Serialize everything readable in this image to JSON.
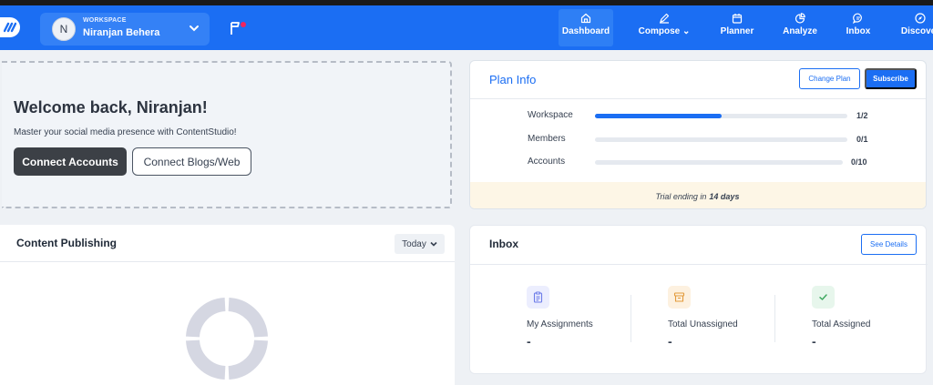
{
  "header": {
    "workspace_tag": "WORKSPACE",
    "workspace_name": "Niranjan Behera",
    "avatar_initial": "N",
    "tabs": [
      {
        "label": "Dashboard",
        "icon": "home-icon"
      },
      {
        "label": "Compose",
        "icon": "pen-icon"
      },
      {
        "label": "Planner",
        "icon": "calendar-icon"
      },
      {
        "label": "Analyze",
        "icon": "pie-chart-icon"
      },
      {
        "label": "Inbox",
        "icon": "chat-icon"
      },
      {
        "label": "Discover",
        "icon": "compass-icon"
      }
    ],
    "active_tab": "Dashboard",
    "colors": {
      "primary": "#1b6ef3",
      "flag_dot": "#f0255f"
    }
  },
  "welcome": {
    "title": "Welcome back, Niranjan!",
    "subtitle": "Master your social media presence with ContentStudio!",
    "connect_accounts": "Connect Accounts",
    "connect_blogs": "Connect Blogs/Web"
  },
  "plan": {
    "title": "Plan Info",
    "change_plan": "Change Plan",
    "subscribe": "Subscribe",
    "usage": [
      {
        "label": "Workspace",
        "value": "1/2",
        "fraction": 0.5
      },
      {
        "label": "Members",
        "value": "0/1",
        "fraction": 0
      },
      {
        "label": "Accounts",
        "value": "0/10",
        "fraction": 0
      }
    ],
    "trial_prefix": "Trial ending in",
    "trial_days": "14 days"
  },
  "publishing": {
    "title": "Content Publishing",
    "range": "Today"
  },
  "inbox": {
    "title": "Inbox",
    "see_details": "See Details",
    "stats": [
      {
        "label": "My Assignments",
        "value": "-",
        "icon": "clipboard-icon"
      },
      {
        "label": "Total Unassigned",
        "value": "-",
        "icon": "archive-box-icon"
      },
      {
        "label": "Total Assigned",
        "value": "-",
        "icon": "check-icon"
      }
    ]
  }
}
